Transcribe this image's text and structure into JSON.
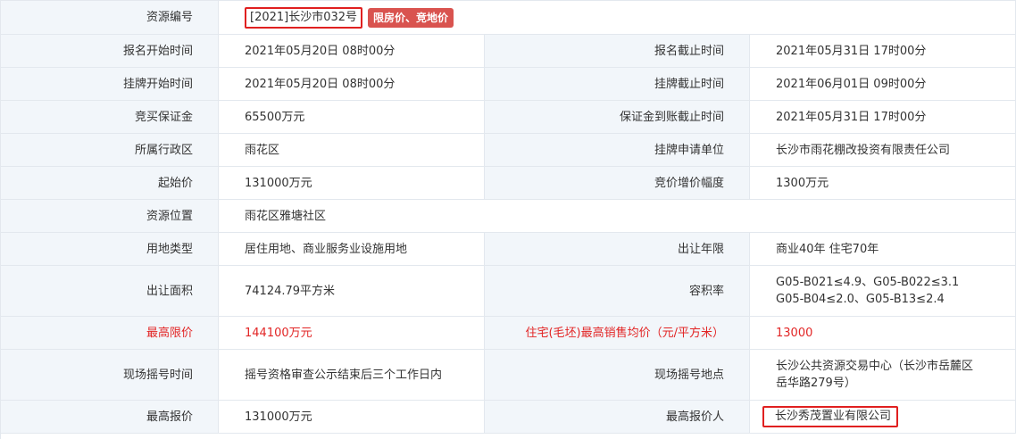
{
  "resource_no": {
    "label": "资源编号",
    "value": "[2021]长沙市032号",
    "badge": "限房价、竞地价"
  },
  "rows": [
    {
      "l1": "报名开始时间",
      "v1": "2021年05月20日 08时00分",
      "l2": "报名截止时间",
      "v2": "2021年05月31日 17时00分"
    },
    {
      "l1": "挂牌开始时间",
      "v1": "2021年05月20日 08时00分",
      "l2": "挂牌截止时间",
      "v2": "2021年06月01日 09时00分"
    },
    {
      "l1": "竞买保证金",
      "v1": "65500万元",
      "l2": "保证金到账截止时间",
      "v2": "2021年05月31日 17时00分"
    },
    {
      "l1": "所属行政区",
      "v1": "雨花区",
      "l2": "挂牌申请单位",
      "v2": "长沙市雨花棚改投资有限责任公司"
    },
    {
      "l1": "起始价",
      "v1": "131000万元",
      "l2": "竞价增价幅度",
      "v2": "1300万元"
    }
  ],
  "location": {
    "label": "资源位置",
    "value": "雨花区雅塘社区"
  },
  "land_use": {
    "l1": "用地类型",
    "v1": "居住用地、商业服务业设施用地",
    "l2": "出让年限",
    "v2": "商业40年 住宅70年"
  },
  "area": {
    "l1": "出让面积",
    "v1": "74124.79平方米",
    "l2": "容积率",
    "v2_line1": "G05-B021≤4.9、G05-B022≤3.1",
    "v2_line2": "G05-B04≤2.0、G05-B13≤2.4"
  },
  "max_limit": {
    "l1": "最高限价",
    "v1": "144100万元",
    "l2": "住宅(毛坯)最高销售均价（元/平方米）",
    "v2": "13000"
  },
  "lottery": {
    "l1": "现场摇号时间",
    "v1": "摇号资格审查公示结束后三个工作日内",
    "l2": "现场摇号地点",
    "v2_line1": "长沙公共资源交易中心（长沙市岳麓区",
    "v2_line2": "岳华路279号）"
  },
  "top_bid": {
    "l1": "最高报价",
    "v1": "131000万元",
    "l2": "最高报价人",
    "v2": "长沙秀茂置业有限公司"
  },
  "colors": {
    "label_bg": "#f2f6fa",
    "border": "#e3e8ee",
    "highlight_red": "#e22525",
    "badge_bg": "#d9534f",
    "box_red": "#e02020"
  }
}
